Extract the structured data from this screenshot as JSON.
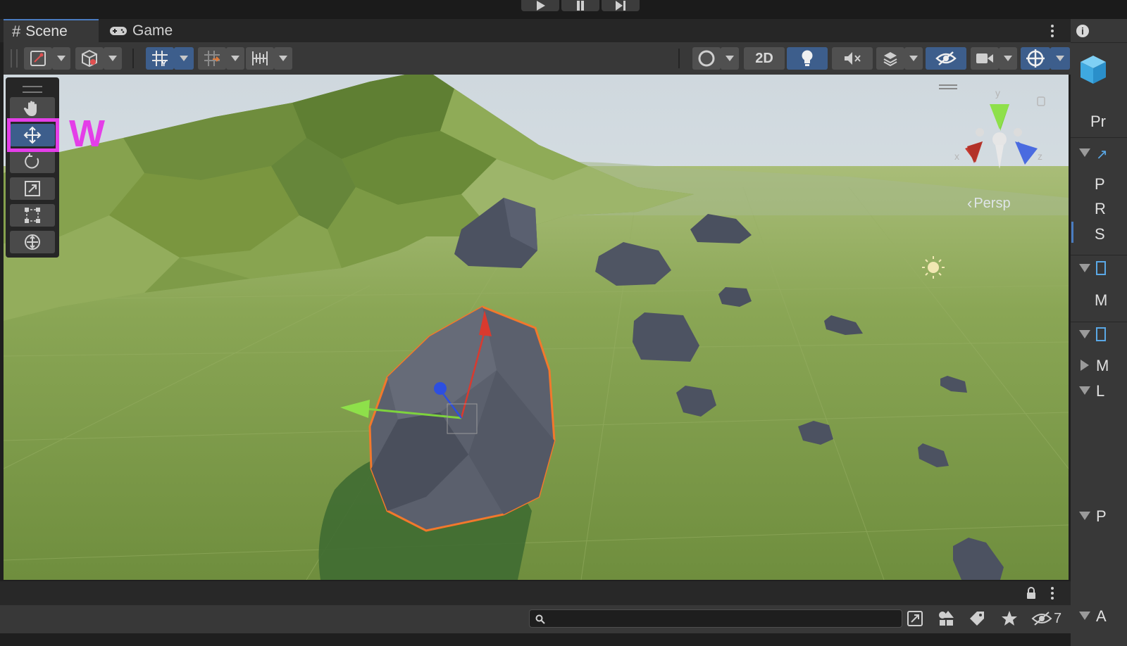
{
  "play_controls": [
    "play-icon",
    "pause-icon",
    "step-icon"
  ],
  "tabs": [
    {
      "label": "Scene",
      "icon": "grid-icon",
      "active": true
    },
    {
      "label": "Game",
      "icon": "gamepad-icon",
      "active": false
    }
  ],
  "toolbar": {
    "left": [
      "tool-handle-icon",
      "draw-mode-icon",
      "grid-snap-icon",
      "increment-snap-icon",
      "ruler-icon"
    ],
    "right": {
      "shading": "sphere-shading-icon",
      "mode_2d_label": "2D",
      "lighting": "light-bulb-icon",
      "audio": "audio-mute-icon",
      "effects": "effects-icon",
      "visibility": "hidden-eye-icon",
      "camera": "camera-icon",
      "gizmos": "gizmo-icon"
    }
  },
  "tools": [
    "hand-icon",
    "move-icon",
    "rotate-icon",
    "scale-icon",
    "rect-icon",
    "transform-icon"
  ],
  "annotation": {
    "label": "W",
    "color": "#e43ee8"
  },
  "gizmo": {
    "y_label": "y",
    "x_label": "x",
    "z_label": "z",
    "projection": "Persp"
  },
  "scene_colors": {
    "ground": "#7f9f4a",
    "sky": "#e0e6e9",
    "rock": "#4f5563",
    "selection": "#f2782c"
  },
  "bottom": {
    "search_placeholder": "",
    "hidden_count": "7"
  },
  "right_panel": {
    "letters": [
      "Pr",
      "P",
      "R",
      "S",
      "M",
      "M",
      "L",
      "P",
      "A"
    ]
  }
}
